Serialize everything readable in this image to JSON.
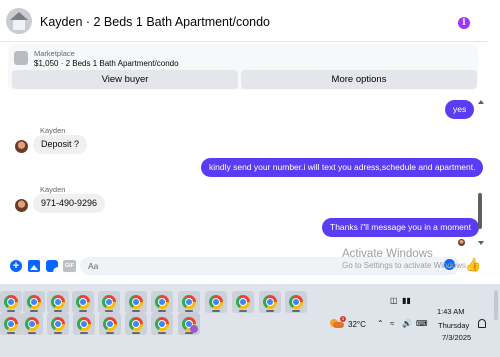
{
  "header": {
    "title": "Kayden · 2 Beds 1 Bath Apartment/condo",
    "info_icon": "info-icon",
    "accent": "#a033ff"
  },
  "marketplace": {
    "label": "Marketplace",
    "listing": "$1,050 · 2 Beds 1 Bath Apartment/condo",
    "view_buyer": "View buyer",
    "more_options": "More options"
  },
  "messages": [
    {
      "direction": "out",
      "text": "yes"
    },
    {
      "direction": "in",
      "sender": "Kayden",
      "text": "Deposit ?"
    },
    {
      "direction": "out",
      "text": "kindly send your number.i will text you adress,schedule and apartment."
    },
    {
      "direction": "in",
      "sender": "Kayden",
      "text": "971-490-9296"
    },
    {
      "direction": "out",
      "text": "Thanks i\"ll message you in a moment"
    }
  ],
  "composer": {
    "placeholder": "Aa",
    "gif_label": "GIF",
    "icons": [
      "plus-icon",
      "photo-icon",
      "sticker-icon",
      "gif-icon",
      "emoji-icon",
      "like-icon"
    ]
  },
  "watermark": {
    "title": "Activate Windows",
    "subtitle": "Go to Settings to activate Windows."
  },
  "taskbar": {
    "weather": "32°C",
    "weather_badge": "1",
    "time": "1:43 AM",
    "day": "Thursday",
    "date": "7/3/2025",
    "apps": [
      "chrome-icon"
    ]
  },
  "colors": {
    "outgoing_bubble": "#5b3cf5",
    "incoming_bubble": "#f0f0f0",
    "brand": "#0866ff"
  }
}
